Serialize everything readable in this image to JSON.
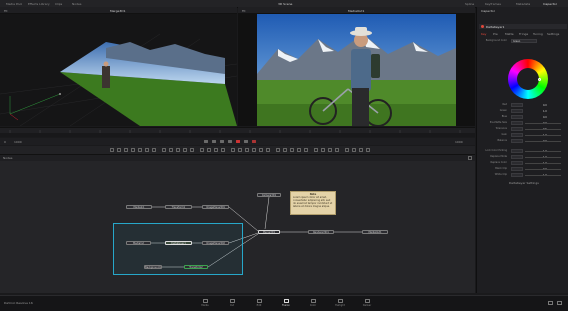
{
  "topbar": {
    "items": [
      "Media Pool",
      "Effects Library",
      "Clips",
      "Nodes"
    ],
    "project_title": "3D Scene",
    "right_items": [
      "Spline",
      "Keyframes",
      "Metadata",
      "Inspector"
    ]
  },
  "viewer_left": {
    "title": "Merge3D1",
    "zoom": "Fit"
  },
  "viewer_right": {
    "title": "MediaOut1",
    "zoom": "Fit"
  },
  "timeline": {
    "start_frame": "0",
    "end_frame": "1000",
    "current": "1000"
  },
  "nodes_header": {
    "title": "Nodes"
  },
  "nodes": [
    {
      "label": "MediaIn1"
    },
    {
      "label": "Transform1"
    },
    {
      "label": "ImagePlane3D1"
    },
    {
      "label": "Camera3D1"
    },
    {
      "label": "Merge3D1"
    },
    {
      "label": "Renderer3D1"
    },
    {
      "label": "MediaOut1"
    },
    {
      "label": "MediaIn2"
    },
    {
      "label": "DeltaKeyer1"
    },
    {
      "label": "ImagePlane3D2"
    },
    {
      "label": "Transform2"
    },
    {
      "label": "Background1"
    }
  ],
  "sticky_note": {
    "title": "Note",
    "text": "Lorem ipsum dolor sit amet, consectetur adipiscing elit, sed do eiusmod tempor incididunt ut labore et dolore magna aliqua."
  },
  "inspector": {
    "title": "Inspector",
    "node_name": "DeltaKeyer1",
    "tabs": [
      "Key",
      "Pre",
      "Matte",
      "Fringe",
      "Tuning",
      "Settings"
    ],
    "fields": [
      {
        "label": "Background Color",
        "value": "Green"
      },
      {
        "label": "Red",
        "value": "0.0"
      },
      {
        "label": "Green",
        "value": "1.0"
      },
      {
        "label": "Blue",
        "value": "0.0"
      },
      {
        "label": "Pre-Matte Size",
        "value": "0.0"
      },
      {
        "label": "Tolerance",
        "value": "0.5"
      },
      {
        "label": "Gain",
        "value": "1.0"
      },
      {
        "label": "Balance",
        "value": "0.0"
      },
      {
        "label": "Lock Color Picking",
        "value": "1.0"
      },
      {
        "label": "Replace Mode",
        "value": "1.0"
      },
      {
        "label": "Replace Color",
        "value": "1.0"
      },
      {
        "label": "Black Clip",
        "value": "0.0"
      },
      {
        "label": "White Clip",
        "value": "1.0"
      }
    ],
    "footer": "DeltaKeyer Settings"
  },
  "statusbar": {
    "app": "DaVinci Resolve 16"
  },
  "pages": [
    {
      "label": "Media",
      "icon": "media-icon"
    },
    {
      "label": "Cut",
      "icon": "cut-icon"
    },
    {
      "label": "Edit",
      "icon": "edit-icon"
    },
    {
      "label": "Fusion",
      "icon": "fusion-icon"
    },
    {
      "label": "Color",
      "icon": "color-icon"
    },
    {
      "label": "Fairlight",
      "icon": "fairlight-icon"
    },
    {
      "label": "Deliver",
      "icon": "deliver-icon"
    }
  ],
  "colors": {
    "accent": "#e0473a",
    "selection": "#27a7c9"
  }
}
